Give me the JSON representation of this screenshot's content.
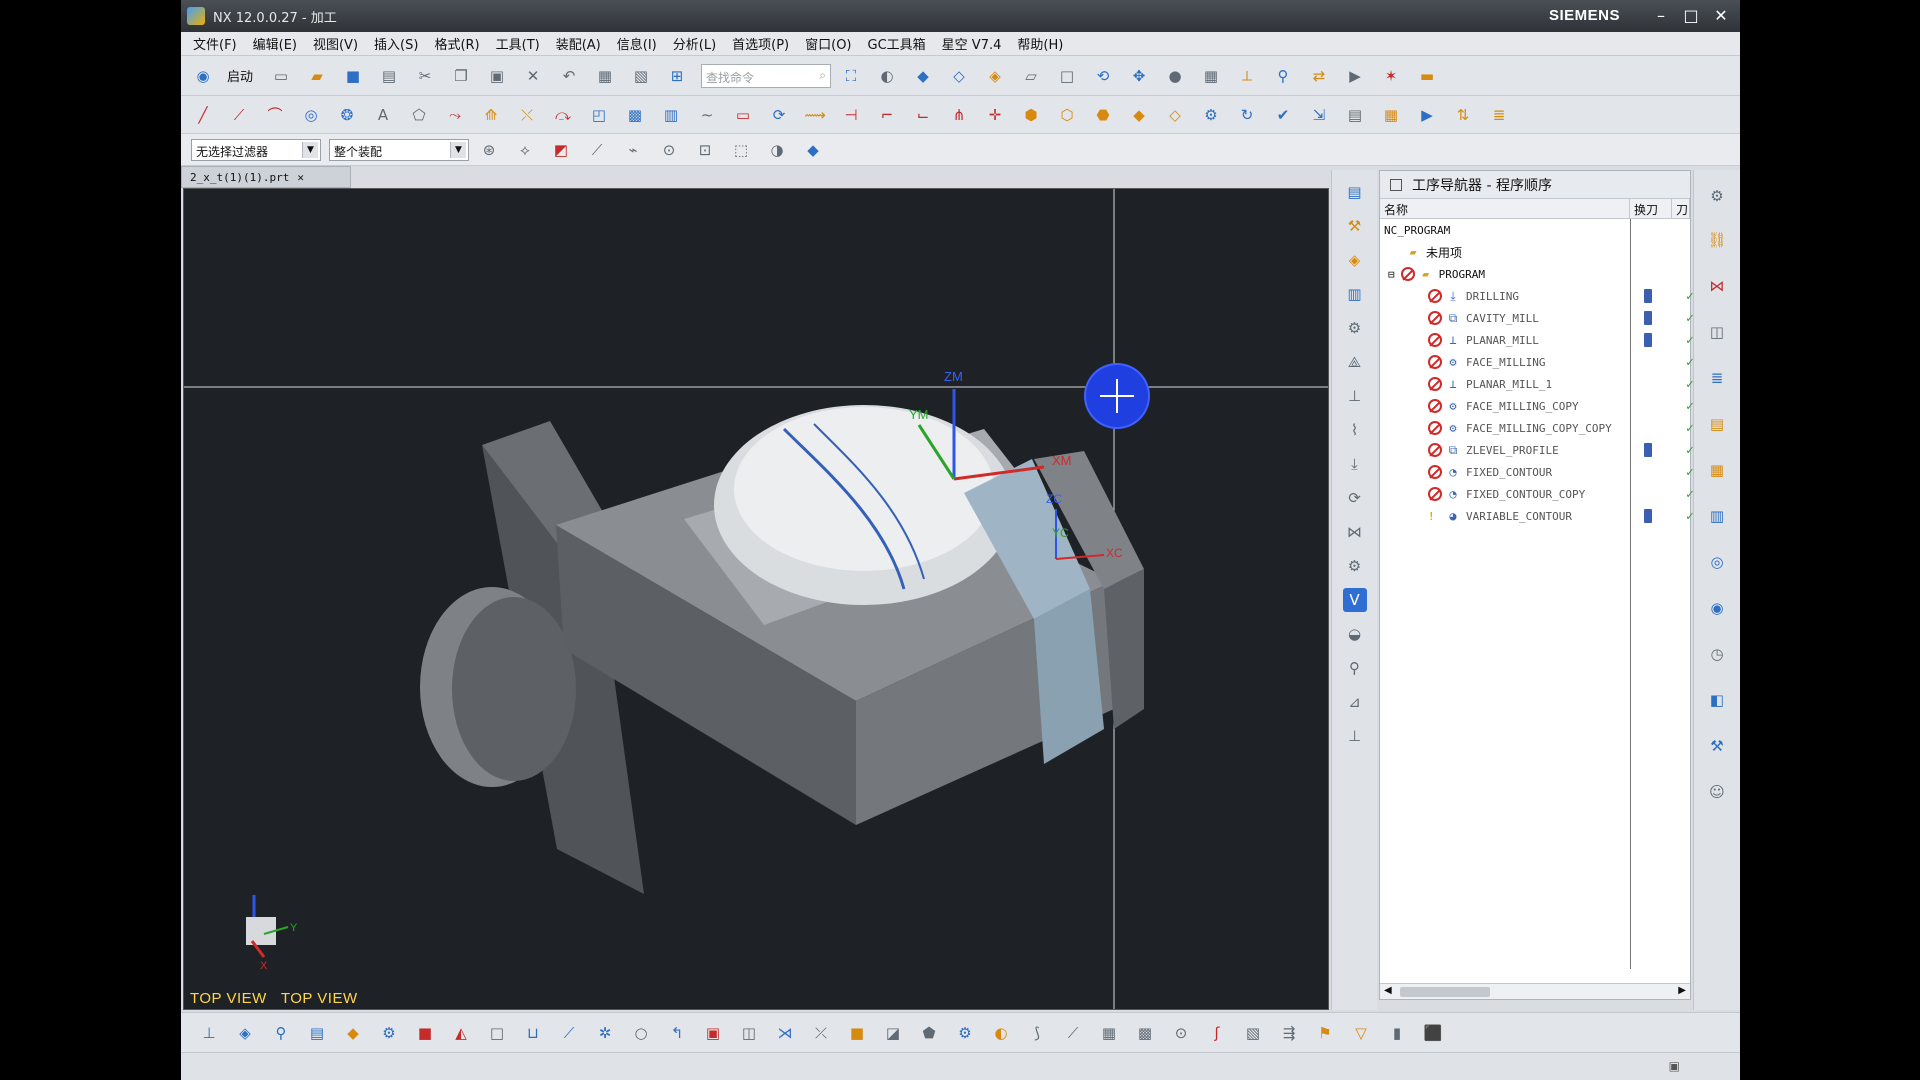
{
  "window": {
    "title": "NX 12.0.0.27 - 加工",
    "brand": "SIEMENS"
  },
  "menu": [
    "文件(F)",
    "编辑(E)",
    "视图(V)",
    "插入(S)",
    "格式(R)",
    "工具(T)",
    "装配(A)",
    "信息(I)",
    "分析(L)",
    "首选项(P)",
    "窗口(O)",
    "GC工具箱",
    "星空 V7.4",
    "帮助(H)"
  ],
  "toolbar": {
    "start_label": "启动",
    "search_placeholder": "查找命令"
  },
  "filters": {
    "selection_filter": "无选择过滤器",
    "assembly_scope": "整个装配"
  },
  "document_tab": {
    "name": "2_x_t(1)(1).prt"
  },
  "viewport": {
    "view_label_1": "TOP VIEW",
    "view_label_2": "TOP VIEW",
    "axes": {
      "zm": "ZM",
      "ym": "YM",
      "xm": "XM",
      "zc": "ZC",
      "yc": "YC",
      "xc": "XC",
      "triad_y": "Y",
      "triad_x": "X"
    }
  },
  "navigator": {
    "title": "工序导航器 - 程序顺序",
    "columns": {
      "name": "名称",
      "tool_change": "换刀",
      "path": "刀"
    },
    "root": "NC_PROGRAM",
    "unused": "未用项",
    "program": "PROGRAM",
    "operations": [
      {
        "name": "DRILLING",
        "tool_change": true,
        "icon": "drilling-icon"
      },
      {
        "name": "CAVITY_MILL",
        "tool_change": true,
        "icon": "cavity-mill-icon"
      },
      {
        "name": "PLANAR_MILL",
        "tool_change": true,
        "icon": "planar-mill-icon"
      },
      {
        "name": "FACE_MILLING",
        "tool_change": false,
        "icon": "face-milling-icon"
      },
      {
        "name": "PLANAR_MILL_1",
        "tool_change": false,
        "icon": "planar-mill-icon"
      },
      {
        "name": "FACE_MILLING_COPY",
        "tool_change": false,
        "icon": "face-milling-icon"
      },
      {
        "name": "FACE_MILLING_COPY_COPY",
        "tool_change": false,
        "icon": "face-milling-icon"
      },
      {
        "name": "ZLEVEL_PROFILE",
        "tool_change": true,
        "icon": "zlevel-profile-icon"
      },
      {
        "name": "FIXED_CONTOUR",
        "tool_change": false,
        "icon": "fixed-contour-icon"
      },
      {
        "name": "FIXED_CONTOUR_COPY",
        "tool_change": false,
        "icon": "fixed-contour-icon"
      },
      {
        "name": "VARIABLE_CONTOUR",
        "tool_change": true,
        "icon": "variable-contour-icon"
      }
    ]
  },
  "colors": {
    "viewport_bg": "#1e2226",
    "view_label": "#ffd54a",
    "accent": "#1f3fe0"
  }
}
